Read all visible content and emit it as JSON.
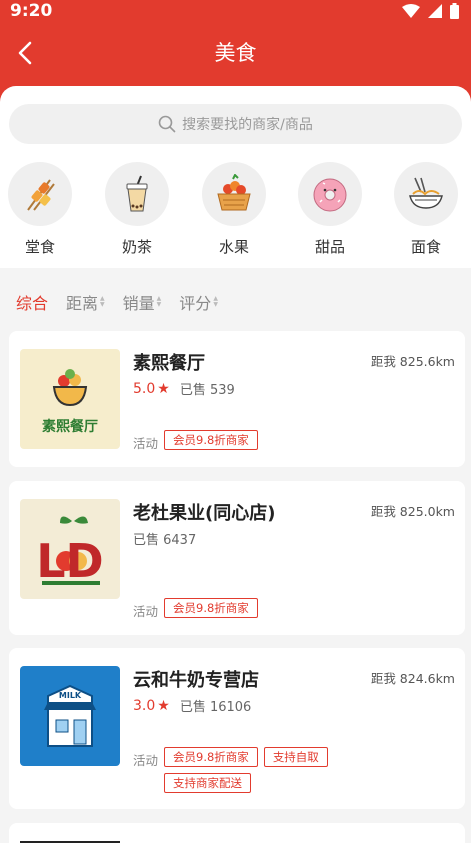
{
  "status": {
    "time": "9:20"
  },
  "header": {
    "title": "美食"
  },
  "search": {
    "placeholder": "搜索要找的商家/商品"
  },
  "categories": [
    {
      "label": "堂食",
      "icon": "skewer-icon"
    },
    {
      "label": "奶茶",
      "icon": "milk-tea-icon"
    },
    {
      "label": "水果",
      "icon": "fruit-basket-icon"
    },
    {
      "label": "甜品",
      "icon": "donut-icon"
    },
    {
      "label": "面食",
      "icon": "noodles-icon"
    }
  ],
  "sort": {
    "items": [
      "综合",
      "距离",
      "销量",
      "评分"
    ],
    "active": "综合"
  },
  "shops": [
    {
      "name": "素熙餐厅",
      "rating": "5.0",
      "sold": "已售 539",
      "distance": "距我 825.6km",
      "activity_label": "活动",
      "tags": [
        "会员9.8折商家"
      ],
      "logo_text": "素熙餐厅"
    },
    {
      "name": "老杜果业(同心店)",
      "rating": "",
      "sold": "已售 6437",
      "distance": "距我 825.0km",
      "activity_label": "活动",
      "tags": [
        "会员9.8折商家"
      ],
      "logo_text": "LD"
    },
    {
      "name": "云和牛奶专营店",
      "rating": "3.0",
      "sold": "已售 16106",
      "distance": "距我 824.6km",
      "activity_label": "活动",
      "tags": [
        "会员9.8折商家",
        "支持自取",
        "支持商家配送"
      ],
      "logo_text": "MILK"
    }
  ],
  "colors": {
    "brand_red": "#e23b2e"
  }
}
